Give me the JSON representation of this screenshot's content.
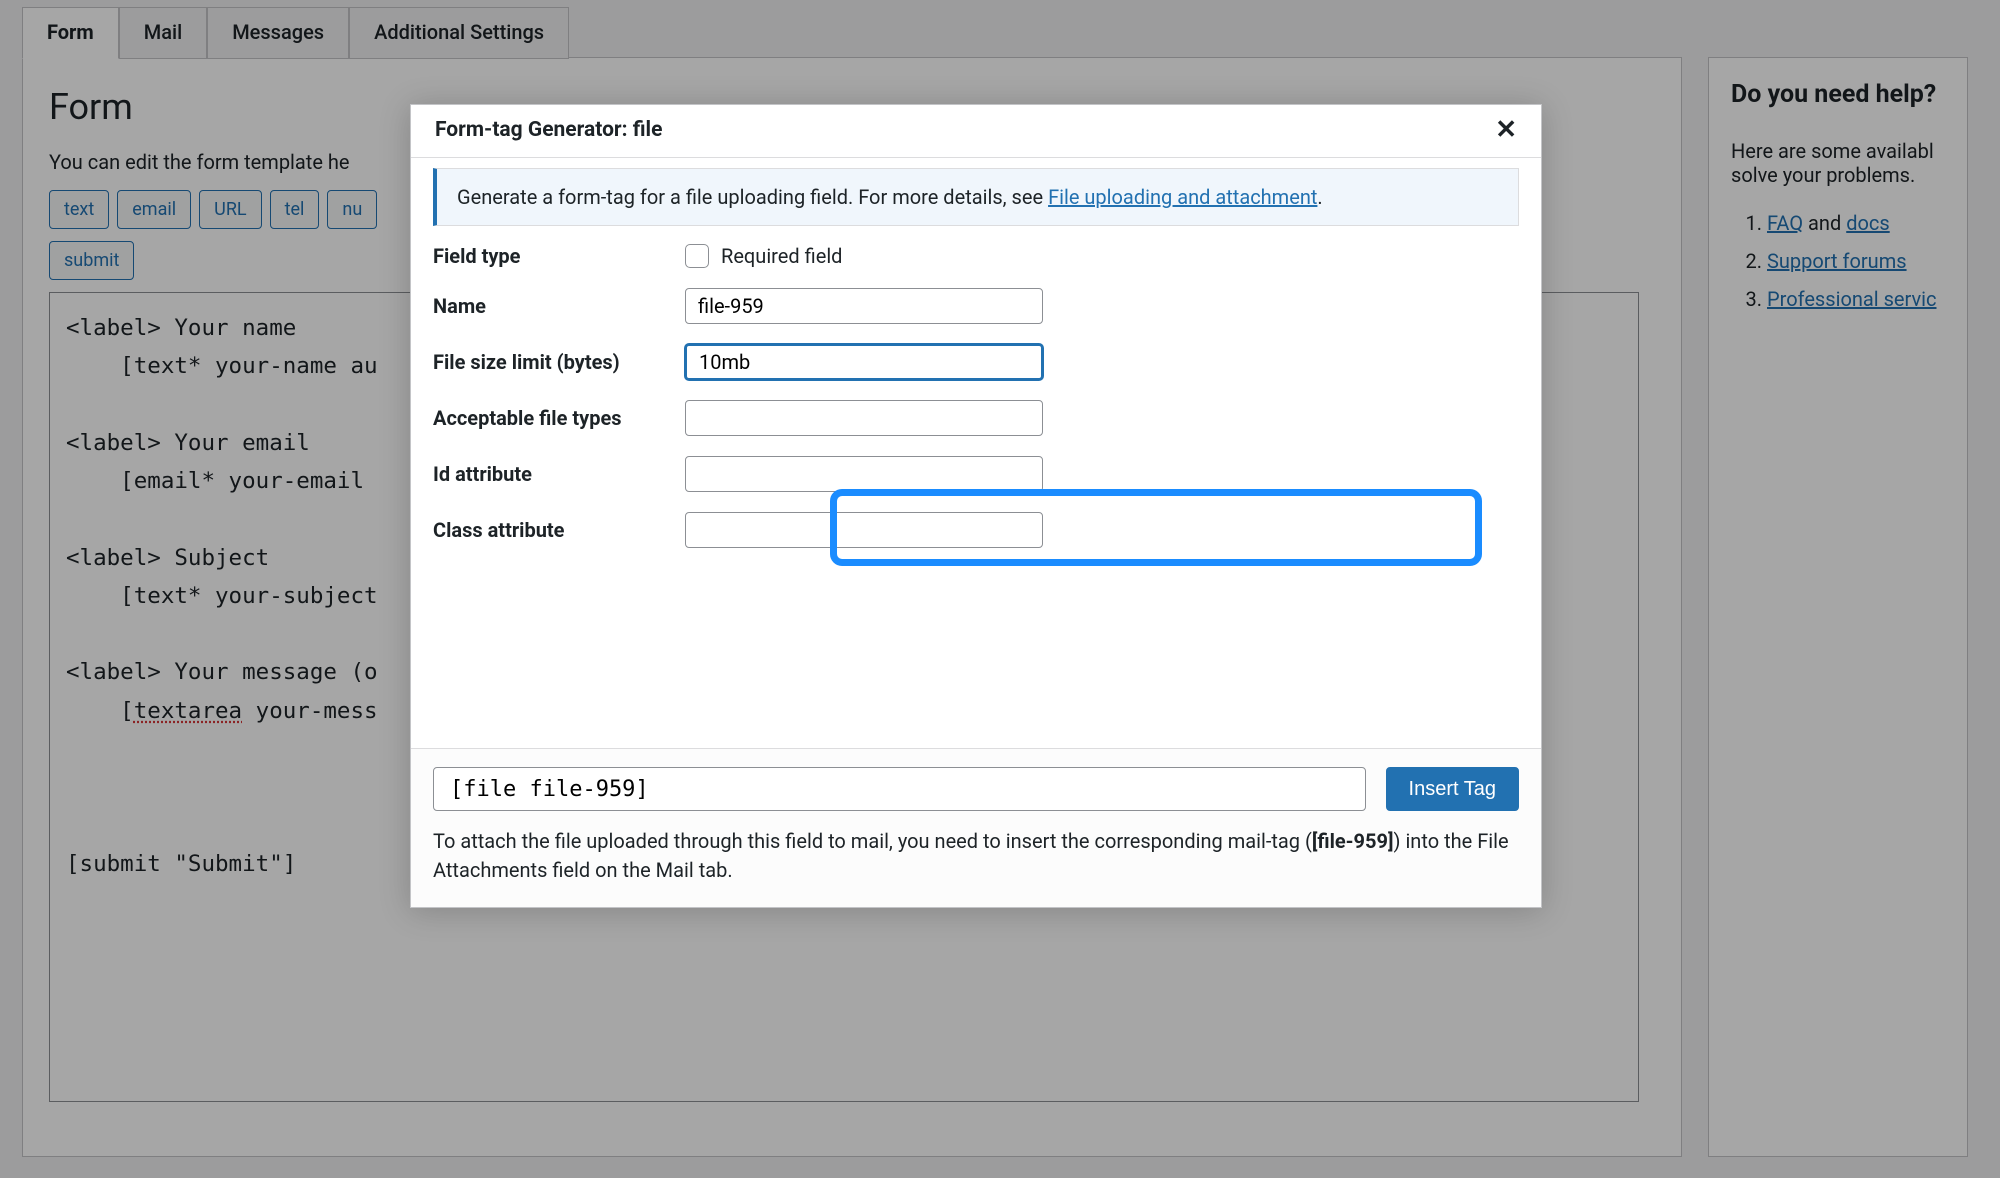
{
  "tabs": [
    "Form",
    "Mail",
    "Messages",
    "Additional Settings"
  ],
  "active_tab": 0,
  "panel": {
    "title": "Form",
    "instruction": "You can edit the form template he",
    "tag_buttons": [
      "text",
      "email",
      "URL",
      "tel",
      "nu"
    ],
    "tag_buttons_row2": [
      "submit"
    ],
    "code": "<label> Your name\n    [text* your-name au\n\n<label> Your email\n    [email* your-email \n\n<label> Subject\n    [text* your-subject\n\n<label> Your message (o\n    [textarea your-mess\n\n\n\n[submit \"Submit\"]"
  },
  "sidebar": {
    "title": "Do you need help?",
    "intro": "Here are some availabl solve your problems.",
    "links": [
      {
        "prefix": "",
        "link": "FAQ",
        "after": " and ",
        "link2": "docs"
      },
      {
        "link": "Support forums"
      },
      {
        "link": "Professional servic"
      }
    ]
  },
  "modal": {
    "title": "Form-tag Generator: file",
    "info_pre": "Generate a form-tag for a file uploading field. For more details, see ",
    "info_link": "File uploading and attachment",
    "info_post": ".",
    "rows": {
      "field_type_label": "Field type",
      "required_label": "Required field",
      "required_checked": false,
      "name_label": "Name",
      "name_value": "file-959",
      "size_label": "File size limit (bytes)",
      "size_value": "10mb",
      "types_label": "Acceptable file types",
      "types_value": "",
      "id_label": "Id attribute",
      "id_value": "",
      "class_label": "Class attribute",
      "class_value": ""
    },
    "footer": {
      "generated": "[file file-959]",
      "insert_label": "Insert Tag",
      "note_pre": "To attach the file uploaded through this field to mail, you need to insert the corresponding mail-tag (",
      "note_tag": "[file-959]",
      "note_post": ") into the File Attachments field on the Mail tab."
    }
  }
}
